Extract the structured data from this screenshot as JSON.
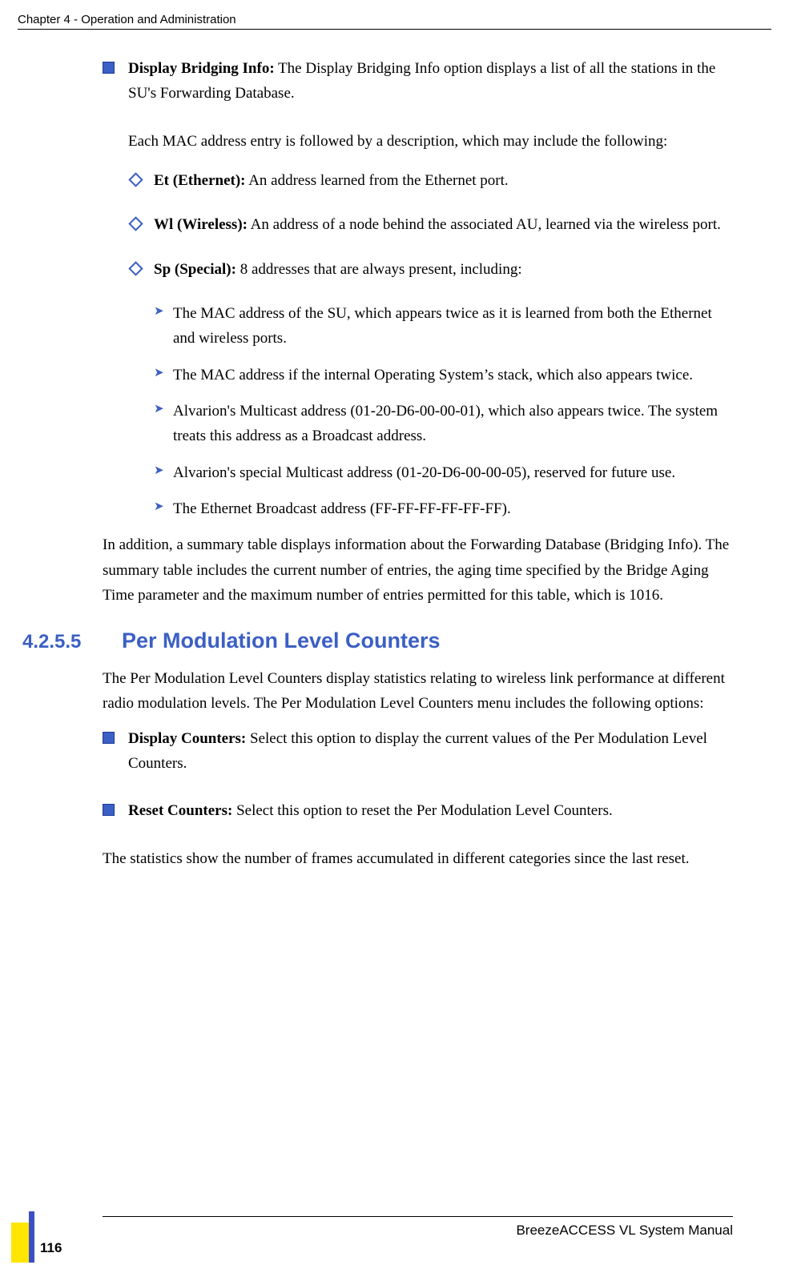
{
  "header": {
    "chapter": "Chapter 4 - Operation and Administration"
  },
  "main": {
    "bridging": {
      "label": "Display Bridging Info:",
      "text": " The Display Bridging Info option displays a list of all the stations in the SU's Forwarding Database.",
      "followup": "Each MAC address entry is followed by a description, which may include the following:",
      "items": [
        {
          "label": "Et (Ethernet):",
          "text": " An address learned from the Ethernet port."
        },
        {
          "label": "Wl (Wireless):",
          "text": " An address of a node behind the associated AU, learned via the wireless port."
        },
        {
          "label": "Sp (Special):",
          "text": " 8 addresses that are always present, including:"
        }
      ],
      "special_items": [
        "The MAC address of the SU, which appears twice as it is learned from both the Ethernet and wireless ports.",
        "The MAC address if the internal Operating System’s stack, which also appears twice.",
        "Alvarion's Multicast address (01-20-D6-00-00-01), which also appears twice. The system treats this address as a Broadcast address.",
        "Alvarion's special Multicast address (01-20-D6-00-00-05), reserved for future use.",
        "The Ethernet Broadcast address (FF-FF-FF-FF-FF-FF)."
      ],
      "summary": "In addition, a summary table displays information about the Forwarding Database (Bridging Info). The summary table includes the current number of entries, the aging time specified by the Bridge Aging Time parameter and the maximum number of entries permitted for this table, which is 1016."
    },
    "section": {
      "number": "4.2.5.5",
      "title": "Per Modulation Level Counters",
      "intro": "The Per Modulation Level Counters display statistics relating to wireless link performance at different radio modulation levels. The Per Modulation Level Counters menu includes the following options:",
      "options": [
        {
          "label": "Display Counters:",
          "text": " Select this option to display the current values of the Per Modulation Level Counters."
        },
        {
          "label": "Reset Counters:",
          "text": " Select this option to reset the Per Modulation Level Counters."
        }
      ],
      "closing": "The statistics show the number of frames accumulated in different categories since the last reset."
    }
  },
  "footer": {
    "manual": "BreezeACCESS VL System Manual",
    "page": "116"
  }
}
